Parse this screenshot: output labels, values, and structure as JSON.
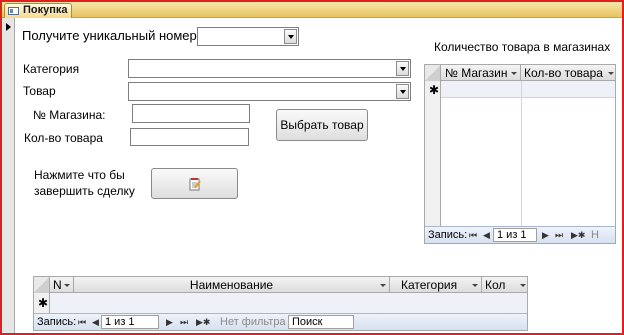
{
  "tab": {
    "title": "Покупка",
    "icon": "form-icon"
  },
  "form": {
    "unique_number_label": "Получите уникальный номер >",
    "unique_number_value": "",
    "category_label": "Категория",
    "category_value": "",
    "product_label": "Товар",
    "product_value": "",
    "store_number_label": "№ Магазина:",
    "store_number_value": "",
    "quantity_label": "Кол-во товара",
    "quantity_value": "",
    "select_product_button": "Выбрать товар",
    "finish_prompt_line1": "Нажмите что бы",
    "finish_prompt_line2": "завершить сделку",
    "finish_button_icon": "notepad-edit-icon"
  },
  "stock_grid": {
    "title": "Количество товара в магазинах",
    "columns": [
      "№ Магазин",
      "Кол-во товара"
    ],
    "new_row_marker": "✱",
    "nav": {
      "records_label": "Запись:",
      "first": "⏮",
      "prev": "◀",
      "position": "1 из 1",
      "next": "▶",
      "last": "⏭",
      "new": "▶✱",
      "filter_label": "Н"
    }
  },
  "order_grid": {
    "columns": [
      "N",
      "Наименование",
      "Категория",
      "Кол"
    ],
    "new_row_marker": "✱",
    "nav": {
      "records_label": "Запись:",
      "first": "⏮",
      "prev": "◀",
      "position": "1 из 1",
      "next": "▶",
      "last": "⏭",
      "new": "▶✱",
      "filter_label": "Нет фильтра",
      "search_label": "Поиск"
    }
  },
  "colors": {
    "frame": "#e0201d",
    "tab_strip": "#f0d486",
    "grid_new_row": "#eef2f8"
  }
}
